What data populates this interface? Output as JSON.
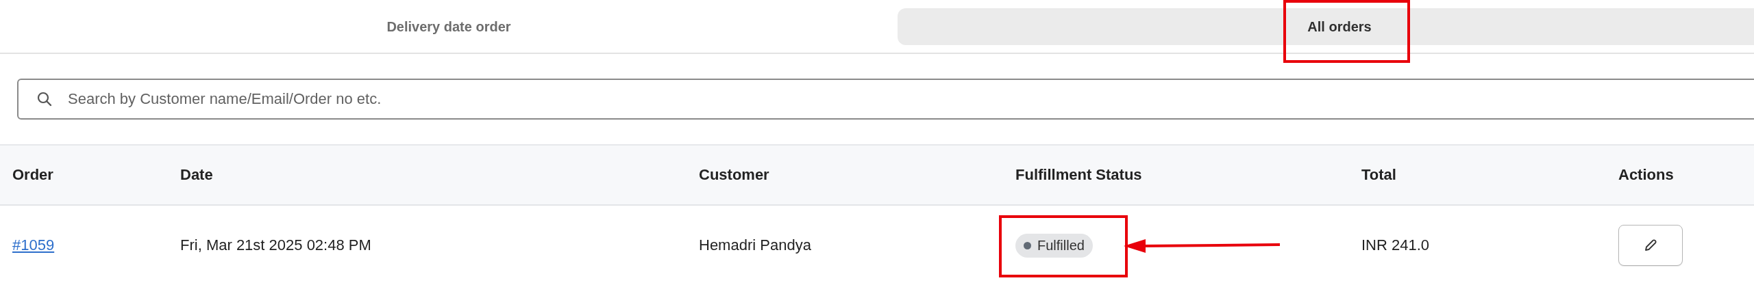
{
  "tabs": [
    {
      "label": "Delivery date order",
      "selected": false
    },
    {
      "label": "All orders",
      "selected": true
    }
  ],
  "search": {
    "placeholder": "Search by Customer name/Email/Order no etc."
  },
  "table": {
    "columns": [
      "Order",
      "Date",
      "Customer",
      "Fulfillment Status",
      "Total",
      "Actions"
    ],
    "rows": [
      {
        "order": "#1059",
        "date": "Fri, Mar 21st 2025 02:48 PM",
        "customer": "Hemadri Pandya",
        "status": "Fulfilled",
        "total": "INR 241.0"
      }
    ]
  }
}
